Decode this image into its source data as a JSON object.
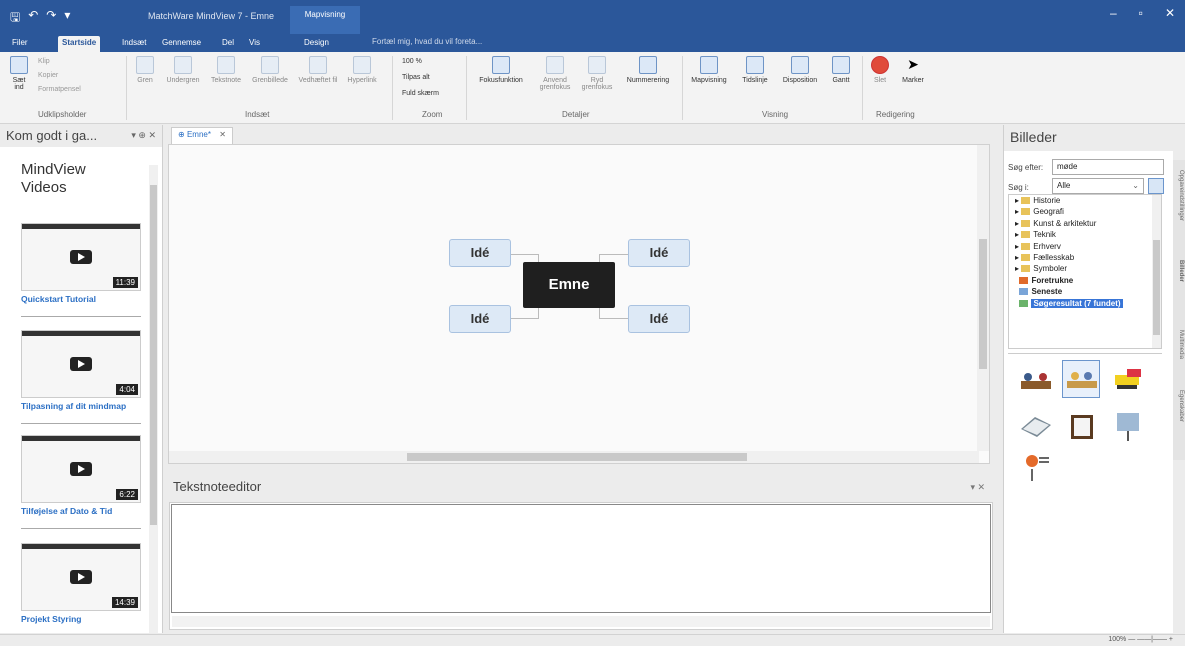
{
  "window": {
    "title": "MatchWare MindView 7 - Emne",
    "context_tab": "Mapvisning"
  },
  "ribbon_tabs": [
    "Filer",
    "Startside",
    "Indsæt",
    "Gennemse",
    "Del",
    "Vis",
    "Design"
  ],
  "active_tab": "Startside",
  "tell_me": "Fortæl mig, hvad du vil foreta...",
  "ribbon": {
    "clipboard": {
      "paste": "Sæt ind",
      "cut": "Klip",
      "copy": "Kopier",
      "format_painter": "Formatpensel",
      "group": "Udklipsholder"
    },
    "insert": {
      "buttons": [
        "Gren",
        "Undergren",
        "Tekstnote",
        "Grenbillede",
        "Vedhæftet fil",
        "Hyperlink"
      ],
      "group": "Indsæt"
    },
    "zoom": {
      "items": [
        "100 %",
        "Tilpas alt",
        "Fuld skærm"
      ],
      "group": "Zoom"
    },
    "details": {
      "buttons": [
        "Fokusfunktion",
        "Anvend grenfokus",
        "Ryd grenfokus",
        "Nummerering"
      ],
      "group": "Detaljer"
    },
    "view": {
      "buttons": [
        "Mapvisning",
        "Tidslinje",
        "Disposition",
        "Gantt"
      ],
      "group": "Visning"
    },
    "editing": {
      "buttons": [
        "Slet",
        "Marker"
      ],
      "group": "Redigering"
    }
  },
  "left_panel": {
    "title": "Kom godt i ga...",
    "heading": "MindView Videos",
    "videos": [
      {
        "label": "Quickstart Tutorial",
        "duration": "11:39"
      },
      {
        "label": "Tilpasning af dit mindmap",
        "duration": "4:04"
      },
      {
        "label": "Tilføjelse af Dato & Tid",
        "duration": "6:22"
      },
      {
        "label": "Projekt Styring",
        "duration": "14:39"
      }
    ]
  },
  "document": {
    "tab": "Emne*",
    "center": "Emne",
    "ideas": [
      "Idé",
      "Idé",
      "Idé",
      "Idé"
    ]
  },
  "note_editor": {
    "title": "Tekstnoteeditor"
  },
  "right_panel": {
    "title": "Billeder",
    "search_label": "Søg efter:",
    "search_value": "møde",
    "in_label": "Søg i:",
    "in_value": "Alle",
    "categories": [
      "Historie",
      "Geografi",
      "Kunst & arkitektur",
      "Teknik",
      "Erhverv",
      "Fællesskab",
      "Symboler",
      "Foretrukne",
      "Seneste",
      "Søgeresultat (7 fundet)"
    ],
    "side_tabs": [
      "Opgaveindstillinger",
      "Billeder",
      "Multimedia",
      "Egenskaber"
    ]
  },
  "status": {
    "zoom": "100%"
  }
}
